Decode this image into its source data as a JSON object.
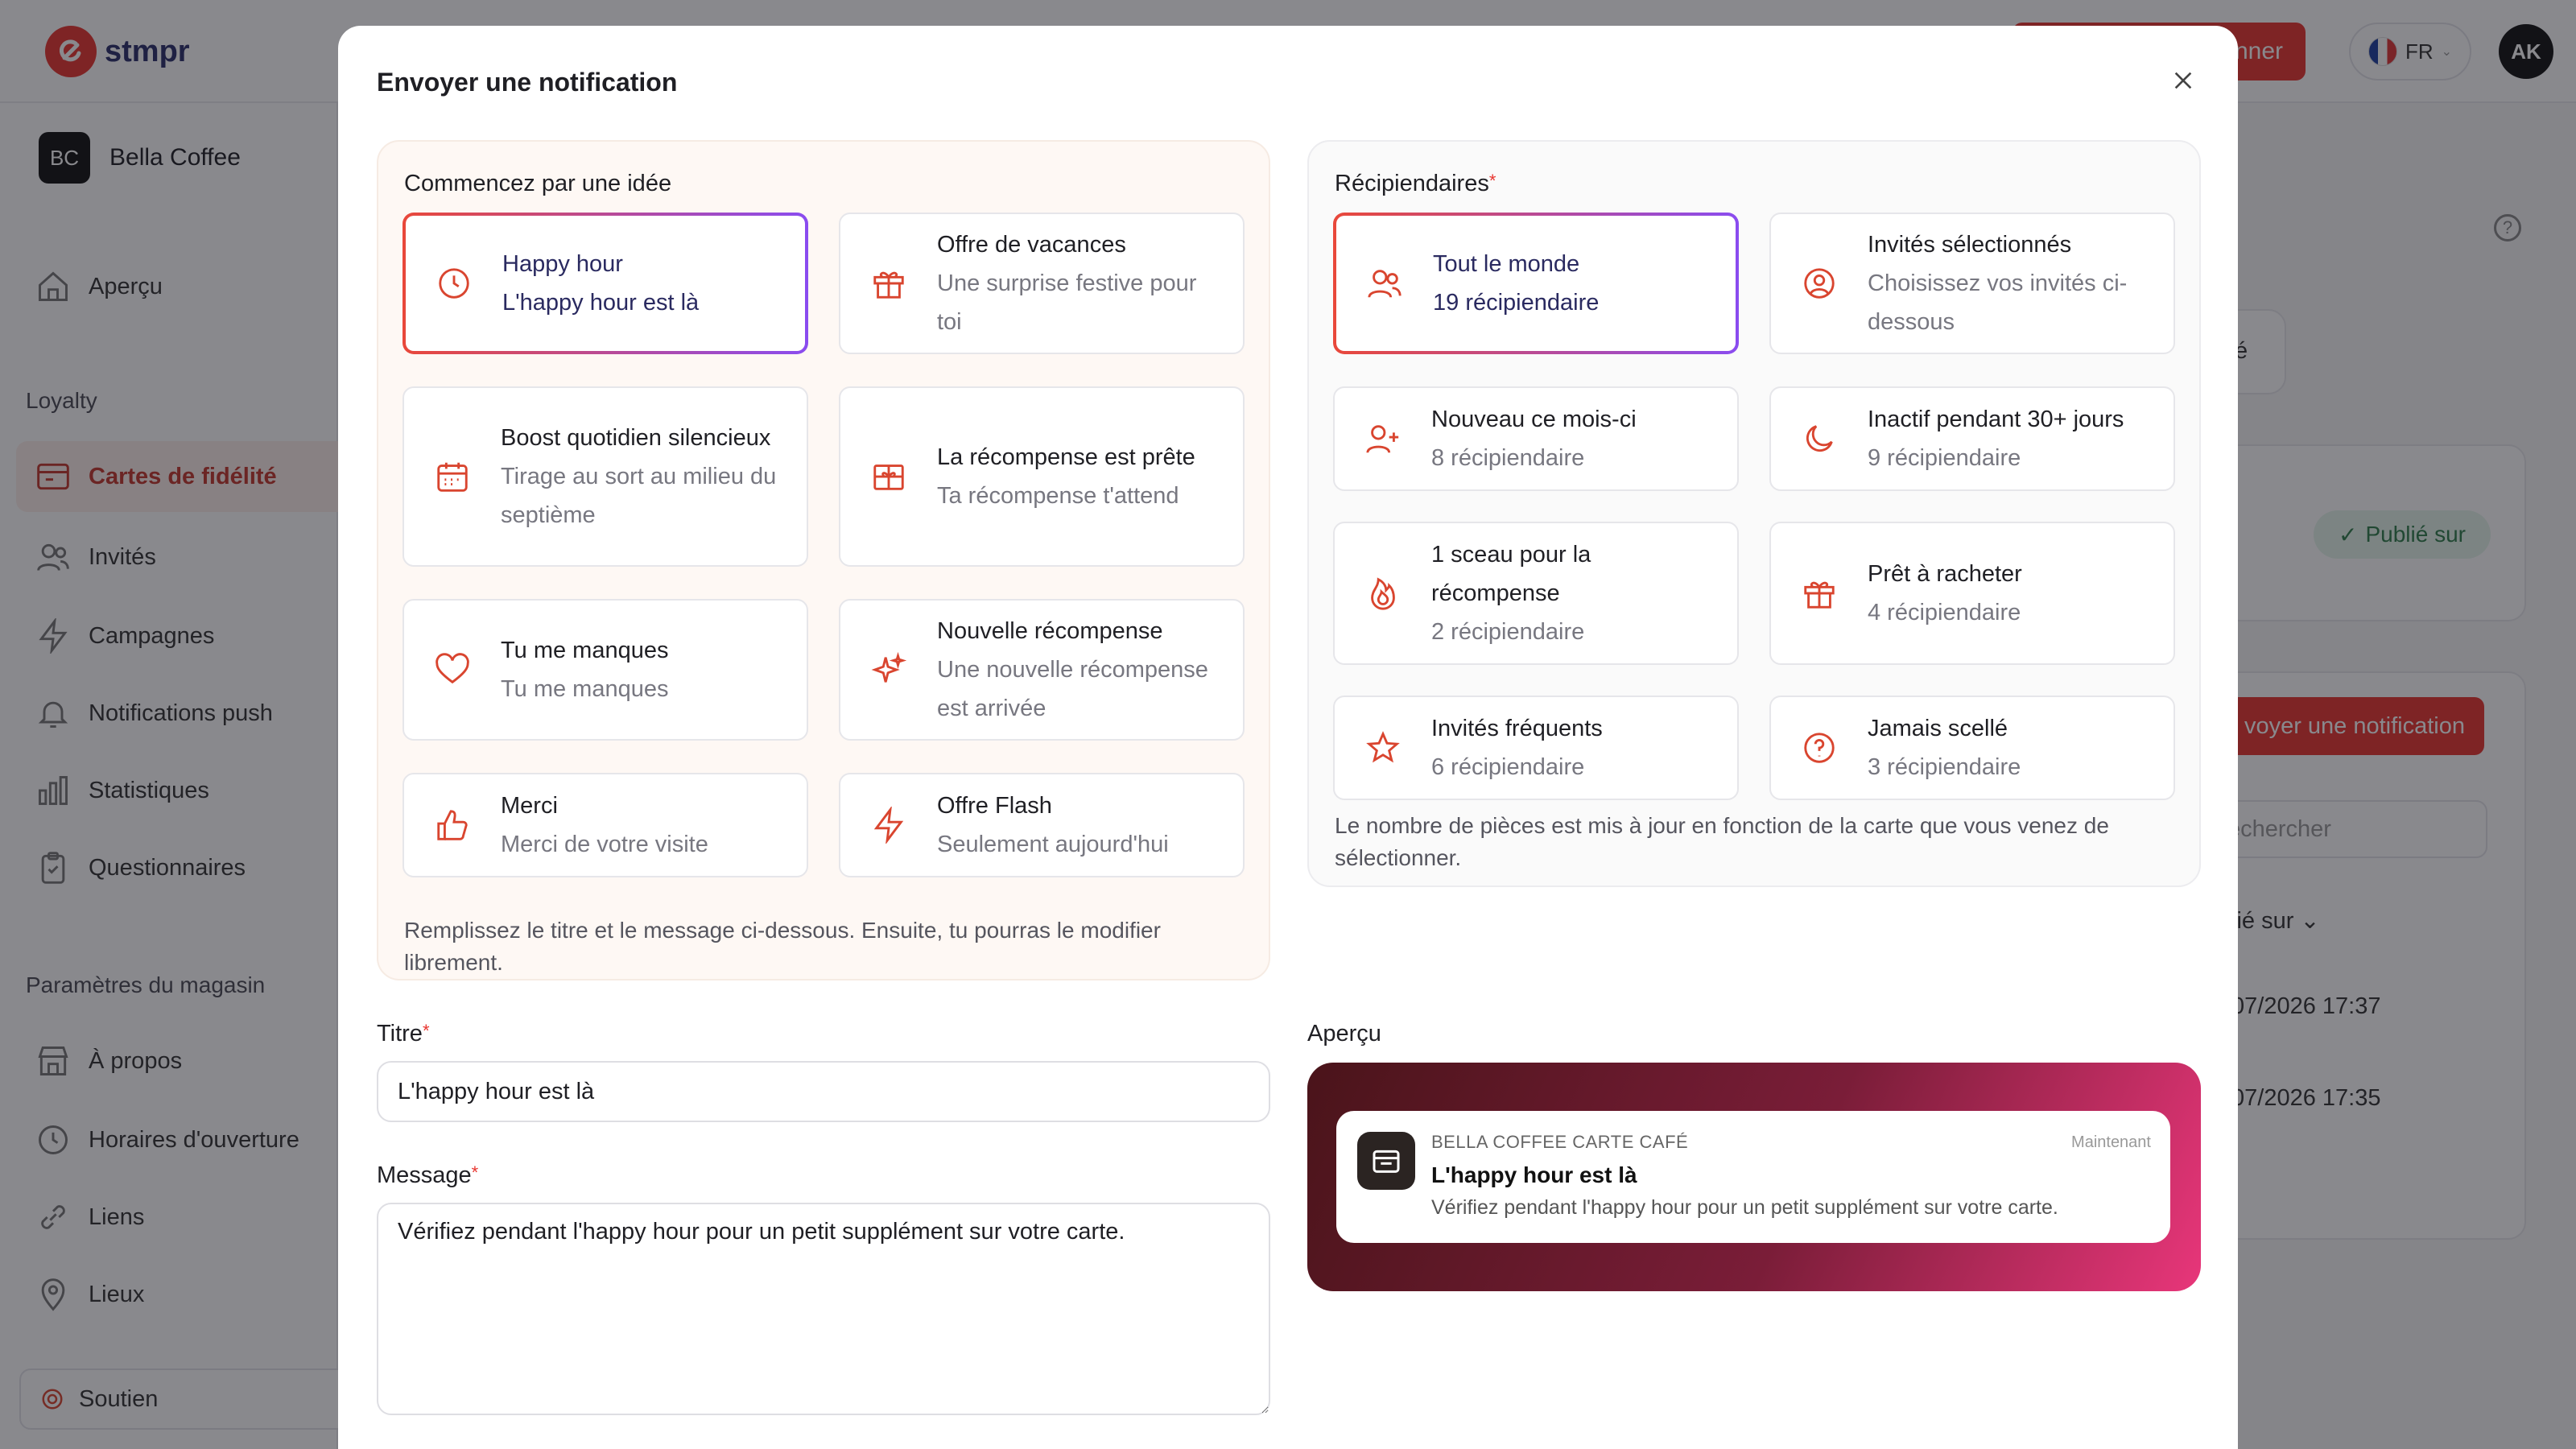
{
  "app": {
    "brand": "stmpr",
    "top_cta": "nner",
    "lang": "FR",
    "avatar": "AK",
    "store_badge": "BC",
    "store_name": "Bella Coffee",
    "nav": {
      "overview": "Aperçu",
      "section_loyalty": "Loyalty",
      "loyalty_cards": "Cartes de fidélité",
      "guests": "Invités",
      "campaigns": "Campagnes",
      "push": "Notifications push",
      "stats": "Statistiques",
      "surveys": "Questionnaires",
      "section_store": "Paramètres du magasin",
      "about": "À propos",
      "hours": "Horaires d'ouverture",
      "links": "Liens",
      "places": "Lieux",
      "support": "Soutien"
    },
    "bg": {
      "chip_text": "té",
      "published_pill": "Publié sur",
      "send_btn": "voyer une notification",
      "search": "Rechercher",
      "col_header": "lié sur",
      "row1": "07/2026 17:37",
      "row2": "07/2026 17:35"
    }
  },
  "modal": {
    "title": "Envoyer une notification",
    "ideas_label": "Commencez par une idée",
    "ideas": [
      {
        "title": "Happy hour",
        "sub": "L'happy hour est là",
        "icon": "clock-icon"
      },
      {
        "title": "Offre de vacances",
        "sub": "Une surprise festive pour toi",
        "icon": "gift-icon"
      },
      {
        "title": "Boost quotidien silencieux",
        "sub": "Tirage au sort au milieu du septième",
        "icon": "calendar-icon"
      },
      {
        "title": "La récompense est prête",
        "sub": "Ta récompense t'attend",
        "icon": "reward-box-icon"
      },
      {
        "title": "Tu me manques",
        "sub": "Tu me manques",
        "icon": "heart-icon"
      },
      {
        "title": "Nouvelle récompense",
        "sub": "Une nouvelle récompense est arrivée",
        "icon": "sparkles-icon"
      },
      {
        "title": "Merci",
        "sub": "Merci de votre visite",
        "icon": "thumbs-up-icon"
      },
      {
        "title": "Offre Flash",
        "sub": "Seulement aujourd'hui",
        "icon": "lightning-icon"
      }
    ],
    "ideas_note": "Remplissez le titre et le message ci-dessous. Ensuite, tu pourras le modifier librement.",
    "recipients_label": "Récipiendaires",
    "recipients": [
      {
        "title": "Tout le monde",
        "sub": "19 récipiendaire",
        "icon": "users-icon"
      },
      {
        "title": "Invités sélectionnés",
        "sub": "Choisissez vos invités ci-dessous",
        "icon": "user-circle-icon"
      },
      {
        "title": "Nouveau ce mois-ci",
        "sub": "8 récipiendaire",
        "icon": "user-plus-icon"
      },
      {
        "title": "Inactif pendant 30+ jours",
        "sub": "9 récipiendaire",
        "icon": "moon-icon"
      },
      {
        "title": "1 sceau pour la récompense",
        "sub": "2 récipiendaire",
        "icon": "flame-icon"
      },
      {
        "title": "Prêt à racheter",
        "sub": "4 récipiendaire",
        "icon": "gift-icon"
      },
      {
        "title": "Invités fréquents",
        "sub": "6 récipiendaire",
        "icon": "star-icon"
      },
      {
        "title": "Jamais scellé",
        "sub": "3 récipiendaire",
        "icon": "question-icon"
      }
    ],
    "recipients_note": "Le nombre de pièces est mis à jour en fonction de la carte que vous venez de sélectionner.",
    "title_label": "Titre",
    "title_value": "L'happy hour est là",
    "message_label": "Message",
    "message_value": "Vérifiez pendant l'happy hour pour un petit supplément sur votre carte.",
    "preview_label": "Aperçu",
    "preview": {
      "app_name": "BELLA COFFEE CARTE CAFÉ",
      "time": "Maintenant",
      "title": "L'happy hour est là",
      "message": "Vérifiez pendant l'happy hour pour un petit supplément sur votre carte."
    },
    "colors": {
      "accent": "#e9483a",
      "accent2": "#8a4cf0",
      "icon": "#d9452f"
    }
  }
}
